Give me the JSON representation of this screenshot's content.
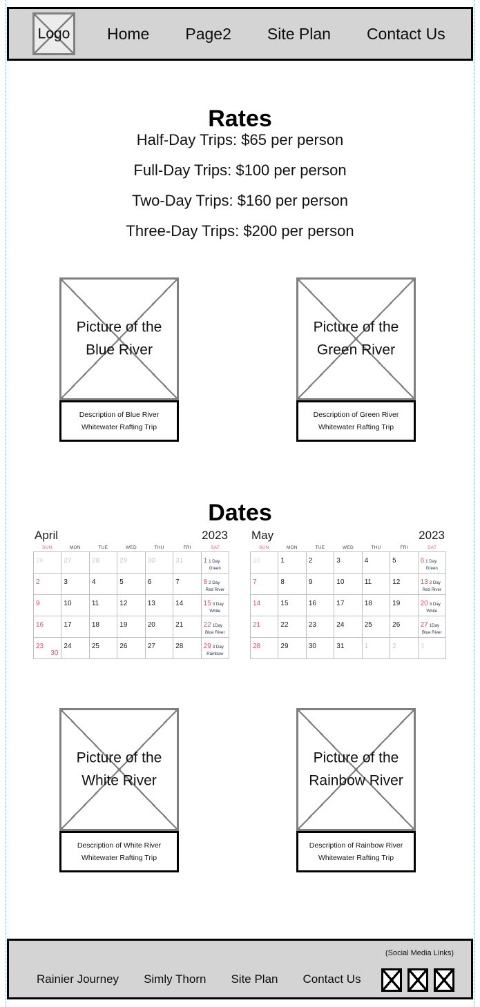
{
  "header": {
    "logo_label": "Logo",
    "nav": [
      {
        "label": "Home"
      },
      {
        "label": "Page2"
      },
      {
        "label": "Site Plan"
      },
      {
        "label": "Contact Us"
      }
    ]
  },
  "rates": {
    "title": "Rates",
    "lines": [
      "Half-Day Trips: $65 per person",
      "Full-Day Trips: $100 per person",
      "Two-Day Trips: $160 per person",
      "Three-Day Trips: $200 per person"
    ]
  },
  "dates": {
    "title": "Dates"
  },
  "cards": [
    {
      "image_label_line1": "Picture of the",
      "image_label_line2": "Blue River",
      "desc_line1": "Description of Blue River",
      "desc_line2": "Whitewater Rafting Trip"
    },
    {
      "image_label_line1": "Picture of the",
      "image_label_line2": "Green River",
      "desc_line1": "Description of Green River",
      "desc_line2": "Whitewater Rafting Trip"
    },
    {
      "image_label_line1": "Picture of the",
      "image_label_line2": "White River",
      "desc_line1": "Description of White River",
      "desc_line2": "Whitewater Rafting Trip"
    },
    {
      "image_label_line1": "Picture of the",
      "image_label_line2": "Rainbow River",
      "desc_line1": "Description of Rainbow River",
      "desc_line2": "Whitewater Rafting Trip"
    }
  ],
  "calendars": [
    {
      "month": "April",
      "year": "2023",
      "dow": [
        "SUN",
        "MON",
        "TUE",
        "WED",
        "THU",
        "FRI",
        "SAT"
      ],
      "weeks": [
        [
          {
            "n": "26",
            "out": true
          },
          {
            "n": "27",
            "out": true
          },
          {
            "n": "28",
            "out": true
          },
          {
            "n": "29",
            "out": true
          },
          {
            "n": "30",
            "out": true
          },
          {
            "n": "31",
            "out": true
          },
          {
            "n": "1",
            "ev1": "1 Day",
            "ev2": "Green"
          }
        ],
        [
          {
            "n": "2"
          },
          {
            "n": "3"
          },
          {
            "n": "4"
          },
          {
            "n": "5"
          },
          {
            "n": "6"
          },
          {
            "n": "7"
          },
          {
            "n": "8",
            "ev1": "2 Day",
            "ev2": "Red River"
          }
        ],
        [
          {
            "n": "9"
          },
          {
            "n": "10"
          },
          {
            "n": "11"
          },
          {
            "n": "12"
          },
          {
            "n": "13"
          },
          {
            "n": "14"
          },
          {
            "n": "15",
            "ev1": "3 Day",
            "ev2": "White"
          }
        ],
        [
          {
            "n": "16"
          },
          {
            "n": "17"
          },
          {
            "n": "18"
          },
          {
            "n": "19"
          },
          {
            "n": "20"
          },
          {
            "n": "21"
          },
          {
            "n": "22",
            "ev1": "1Day",
            "ev2": "Blue River"
          }
        ],
        [
          {
            "n": "23",
            "extra": "30"
          },
          {
            "n": "24"
          },
          {
            "n": "25"
          },
          {
            "n": "26"
          },
          {
            "n": "27"
          },
          {
            "n": "28"
          },
          {
            "n": "29",
            "ev1": "3 Day",
            "ev2": "Rainbow"
          }
        ]
      ]
    },
    {
      "month": "May",
      "year": "2023",
      "dow": [
        "SUN",
        "MON",
        "TUE",
        "WED",
        "THU",
        "FRI",
        "SAT"
      ],
      "weeks": [
        [
          {
            "n": "30",
            "out": true
          },
          {
            "n": "1"
          },
          {
            "n": "2"
          },
          {
            "n": "3"
          },
          {
            "n": "4"
          },
          {
            "n": "5"
          },
          {
            "n": "6",
            "ev1": "1 Day",
            "ev2": "Green"
          }
        ],
        [
          {
            "n": "7"
          },
          {
            "n": "8"
          },
          {
            "n": "9"
          },
          {
            "n": "10"
          },
          {
            "n": "11"
          },
          {
            "n": "12"
          },
          {
            "n": "13",
            "ev1": "2 Day",
            "ev2": "Red River"
          }
        ],
        [
          {
            "n": "14"
          },
          {
            "n": "15"
          },
          {
            "n": "16"
          },
          {
            "n": "17"
          },
          {
            "n": "18"
          },
          {
            "n": "19"
          },
          {
            "n": "20",
            "ev1": "3 Day",
            "ev2": "White"
          }
        ],
        [
          {
            "n": "21"
          },
          {
            "n": "22"
          },
          {
            "n": "23"
          },
          {
            "n": "24"
          },
          {
            "n": "25"
          },
          {
            "n": "26"
          },
          {
            "n": "27",
            "ev1": "1Day",
            "ev2": "Blue River"
          }
        ],
        [
          {
            "n": "28"
          },
          {
            "n": "29"
          },
          {
            "n": "30"
          },
          {
            "n": "31"
          },
          {
            "n": "1",
            "out": true
          },
          {
            "n": "2",
            "out": true
          },
          {
            "n": "3",
            "out": true
          }
        ]
      ]
    }
  ],
  "footer": {
    "social_label": "(Social Media Links)",
    "nav": [
      {
        "label": "Rainier Journey"
      },
      {
        "label": "Simly Thorn"
      },
      {
        "label": "Site Plan"
      },
      {
        "label": "Contact Us"
      }
    ],
    "social_icons": [
      "social-placeholder-icon",
      "social-placeholder-icon",
      "social-placeholder-icon"
    ]
  },
  "colors": {
    "bar_background": "#d4d4d4",
    "bar_border": "#000000",
    "placeholder_gray": "#7f7f7f",
    "weekend_red": "#e2525f",
    "event_text": "#23304a",
    "guide_blue": "#7ea6d8"
  }
}
